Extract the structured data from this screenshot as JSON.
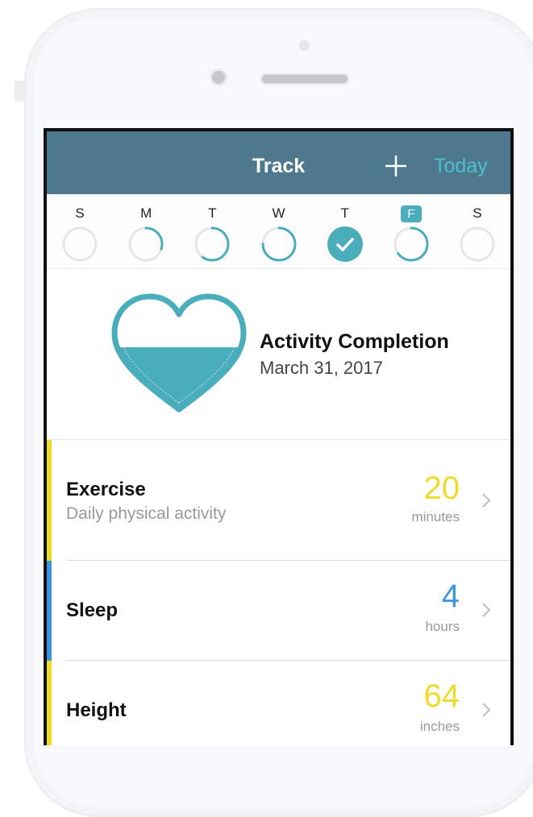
{
  "nav": {
    "title": "Track",
    "today_label": "Today",
    "add_icon": "plus-icon"
  },
  "week": {
    "days": [
      {
        "letter": "S",
        "progress": 0,
        "completed": false,
        "today": false
      },
      {
        "letter": "M",
        "progress": 0.3,
        "completed": false,
        "today": false
      },
      {
        "letter": "T",
        "progress": 0.6,
        "completed": false,
        "today": false
      },
      {
        "letter": "W",
        "progress": 0.75,
        "completed": false,
        "today": false
      },
      {
        "letter": "T",
        "progress": 1,
        "completed": true,
        "today": false
      },
      {
        "letter": "F",
        "progress": 0.65,
        "completed": false,
        "today": true
      },
      {
        "letter": "S",
        "progress": 0,
        "completed": false,
        "today": false
      }
    ]
  },
  "summary": {
    "title": "Activity Completion",
    "date": "March 31, 2017",
    "completion": 0.55
  },
  "rows": [
    {
      "title": "Exercise",
      "subtitle": "Daily physical activity",
      "value": "20",
      "unit": "minutes",
      "color": "#f0db2a"
    },
    {
      "title": "Sleep",
      "subtitle": "",
      "value": "4",
      "unit": "hours",
      "color": "#3e95dd"
    },
    {
      "title": "Height",
      "subtitle": "",
      "value": "64",
      "unit": "inches",
      "color": "#f0db2a"
    }
  ],
  "colors": {
    "nav_bg": "#4d788d",
    "accent": "#4aadbb",
    "ring_track": "#e6e6e6",
    "today_text": "#4dbfd0"
  }
}
